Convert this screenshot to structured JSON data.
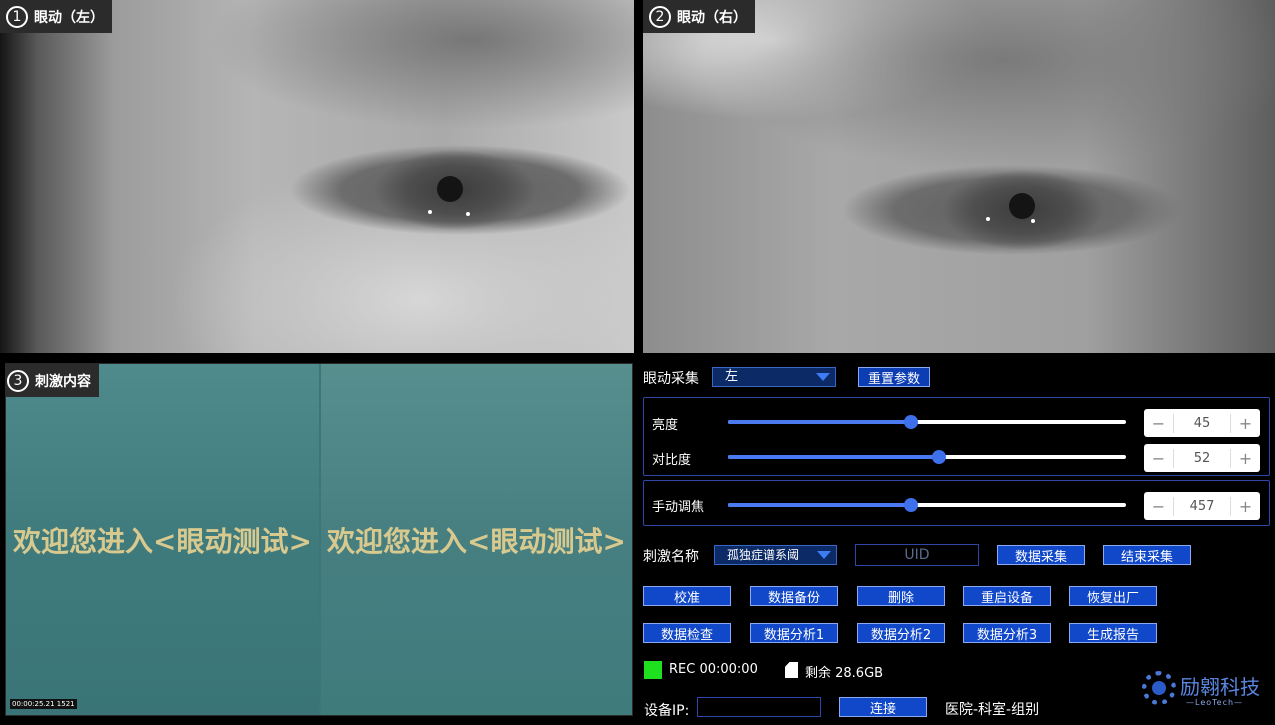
{
  "panes": {
    "left_eye": {
      "num": "1",
      "title": "眼动（左）"
    },
    "right_eye": {
      "num": "2",
      "title": "眼动（右）"
    },
    "stimulus": {
      "num": "3",
      "title": "刺激内容",
      "welcome_left": "欢迎您进入<眼动测试>",
      "welcome_right": "欢迎您进入<眼动测试>",
      "timestamp": "00:00:25.21 1521"
    }
  },
  "controls": {
    "eye_capture_label": "眼动采集",
    "eye_select_value": "左",
    "reset_button": "重置参数",
    "brightness": {
      "label": "亮度",
      "value": "45",
      "fraction": 0.46
    },
    "contrast": {
      "label": "对比度",
      "value": "52",
      "fraction": 0.53
    },
    "focus": {
      "label": "手动调焦",
      "value": "457",
      "fraction": 0.46
    },
    "stepper_minus": "−",
    "stepper_plus": "+",
    "stimulus_name_label": "刺激名称",
    "stimulus_select_value": "孤独症谱系阈",
    "uid_placeholder": "UID",
    "data_capture_button": "数据采集",
    "end_capture_button": "结束采集",
    "row1": [
      "校准",
      "数据备份",
      "删除",
      "重启设备",
      "恢复出厂"
    ],
    "row2": [
      "数据检查",
      "数据分析1",
      "数据分析2",
      "数据分析3",
      "生成报告"
    ],
    "rec_text": "REC 00:00:00",
    "storage_text": "剩余 28.6GB",
    "device_ip_label": "设备IP:",
    "connect_button": "连接",
    "org_text": "医院-科室-组别"
  },
  "logo": {
    "name": "励翱科技",
    "sub": "—LeoTech—"
  },
  "colors": {
    "accent": "#1147c9",
    "rec": "#1fe01f",
    "stimulus_bg": "#4a8485"
  }
}
